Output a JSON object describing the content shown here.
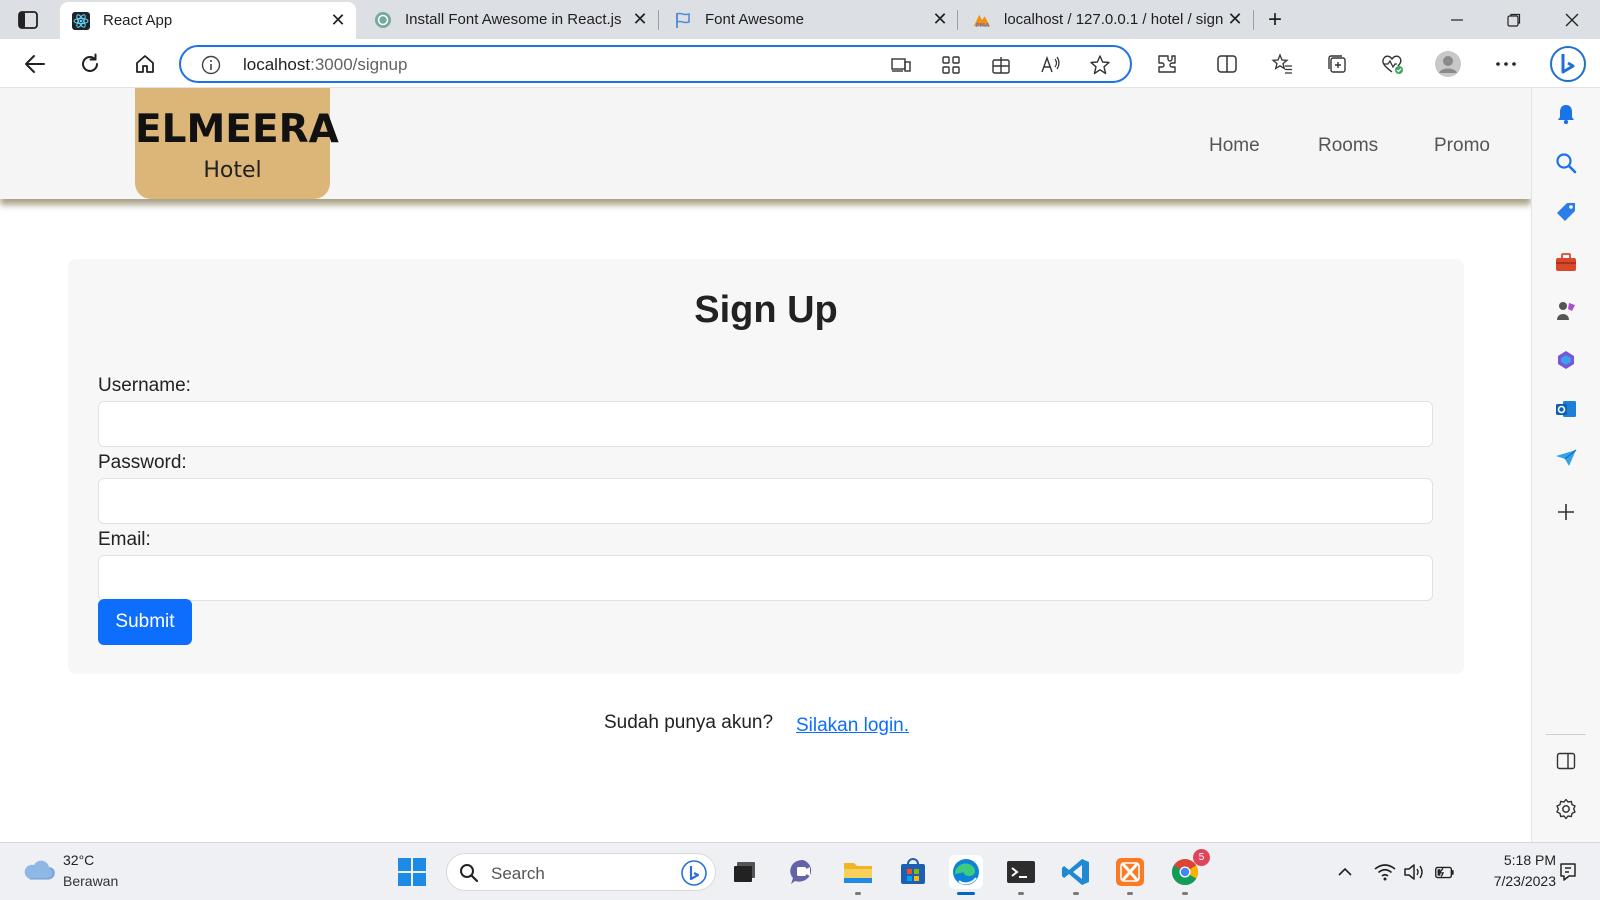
{
  "browser": {
    "tabs": [
      {
        "title": "React App",
        "active": true
      },
      {
        "title": "Install Font Awesome in React.js",
        "active": false
      },
      {
        "title": "Font Awesome",
        "active": false
      },
      {
        "title": "localhost / 127.0.0.1 / hotel / sign",
        "active": false
      }
    ],
    "address": {
      "host": "localhost",
      "path": ":3000/signup"
    },
    "icons": {
      "tab_actions": "tab-actions-icon",
      "back": "back-arrow-icon",
      "reload": "reload-icon",
      "home": "home-icon",
      "site_info": "info-icon",
      "favorites": "star-icon",
      "profile": "profile-avatar-icon"
    }
  },
  "site": {
    "logo": {
      "brand": "ELMEERA",
      "sub": "Hotel"
    },
    "nav": {
      "home": "Home",
      "rooms": "Rooms",
      "promo": "Promo"
    },
    "colors": {
      "logo_bg": "#dcb678",
      "primary": "#0d6efd"
    }
  },
  "signup": {
    "title": "Sign Up",
    "username_label": "Username:",
    "username_value": "",
    "password_label": "Password:",
    "password_value": "",
    "email_label": "Email:",
    "email_value": "",
    "submit_label": "Submit",
    "login_hint": "Sudah punya akun?",
    "login_link": "Silakan login."
  },
  "taskbar": {
    "weather": {
      "temp": "32°C",
      "desc": "Berawan"
    },
    "search_placeholder": "Search",
    "clock": {
      "time": "5:18 PM",
      "date": "7/23/2023"
    },
    "chrome_badge": "5"
  }
}
